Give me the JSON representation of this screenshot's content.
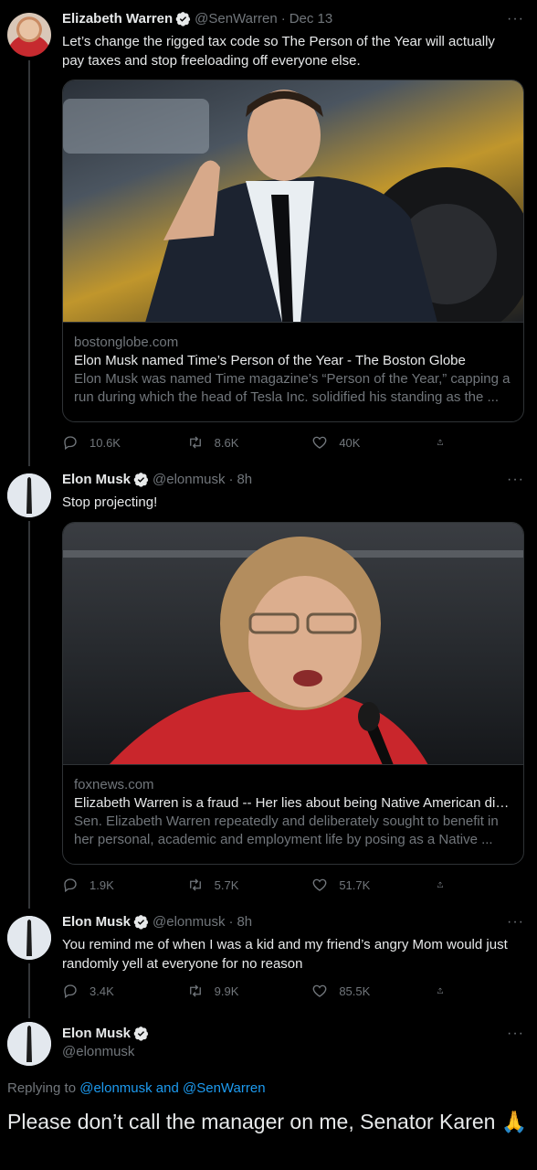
{
  "tweets": [
    {
      "name": "Elizabeth Warren",
      "handle": "@SenWarren",
      "dot": "·",
      "time": "Dec 13",
      "text": "Let’s change the rigged tax code so The Person of the Year will actually pay taxes and stop freeloading off everyone else.",
      "card": {
        "domain": "bostonglobe.com",
        "title": "Elon Musk named Time’s Person of the Year - The Boston Globe",
        "description": "Elon Musk was named Time magazine’s “Person of the Year,” capping a run during which the head of Tesla Inc. solidified his standing as the ..."
      },
      "replies": "10.6K",
      "retweets": "8.6K",
      "likes": "40K"
    },
    {
      "name": "Elon Musk",
      "handle": "@elonmusk",
      "dot": "·",
      "time": "8h",
      "text": "Stop projecting!",
      "card": {
        "domain": "foxnews.com",
        "title": "Elizabeth Warren is a fraud -- Her lies about being Native American dis...",
        "description": "Sen. Elizabeth Warren repeatedly and deliberately sought to benefit in her personal, academic and employment life by posing as a Native ..."
      },
      "replies": "1.9K",
      "retweets": "5.7K",
      "likes": "51.7K"
    },
    {
      "name": "Elon Musk",
      "handle": "@elonmusk",
      "dot": "·",
      "time": "8h",
      "text": "You remind me of when I was a kid and my friend’s angry Mom would just randomly yell at everyone for no reason",
      "replies": "3.4K",
      "retweets": "9.9K",
      "likes": "85.5K"
    }
  ],
  "main": {
    "name": "Elon Musk",
    "handle": "@elonmusk",
    "replying_prefix": "Replying to",
    "replying_to": "@elonmusk and @SenWarren",
    "text": "Please don’t call the manager on me, Senator Karen 🙏"
  },
  "more_label": "···",
  "colors": {
    "background": "#000000",
    "link": "#1d9bf0",
    "muted": "#71767b",
    "verified": "#1d9bf0"
  }
}
